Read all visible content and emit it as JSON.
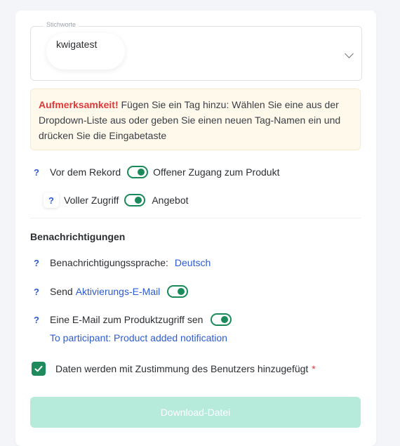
{
  "tags": {
    "legend": "Stichworte",
    "chips": [
      "kwigatest"
    ],
    "dropdown_icon": "chevron-down-icon"
  },
  "warning": {
    "strong": "Aufmerksamkeit!",
    "text": " Fügen Sie ein Tag hinzu: Wählen Sie eine aus der Dropdown-Liste aus oder geben Sie einen neuen Tag-Namen ein und drücken Sie die Eingabetaste"
  },
  "access": {
    "before_record_label": "Vor dem Rekord",
    "before_record_on": true,
    "open_access_label": "Offener Zugang zum Produkt",
    "full_access_label": "Voller Zugriff",
    "full_access_on": true,
    "offer_label": "Angebot"
  },
  "notifications": {
    "title": "Benachrichtigungen",
    "language_label": "Benachrichtigungssprache:",
    "language_value": "Deutsch",
    "send_label": "Send",
    "activation_link": "Aktivierungs-E-Mail",
    "activation_on": true,
    "product_access_label": "Eine E-Mail zum Produktzugriff sen",
    "product_access_on": true,
    "participant_link": "To participant: Product added notification"
  },
  "consent": {
    "checked": true,
    "label": "Daten werden mit Zustimmung des Benutzers hinzugefügt",
    "required_mark": "*"
  },
  "actions": {
    "download_label": "Download-Datei"
  },
  "colors": {
    "accent": "#2d5bd0",
    "toggle": "#1a8a5a",
    "warning_bg": "#fff9ec",
    "warning_text": "#e0373a",
    "button_disabled": "#b6eadb"
  }
}
